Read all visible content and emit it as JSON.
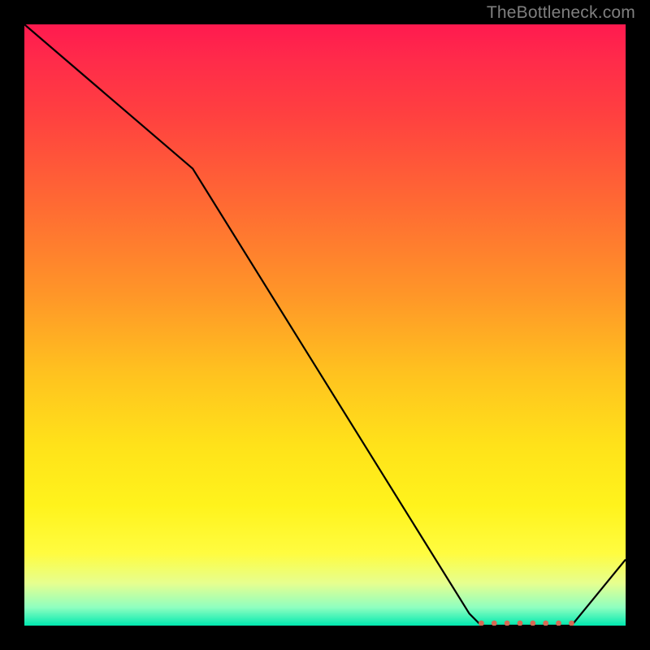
{
  "watermark": "TheBottleneck.com",
  "chart_data": {
    "type": "line",
    "title": "",
    "xlabel": "",
    "ylabel": "",
    "xlim": [
      0,
      100
    ],
    "ylim": [
      0,
      100
    ],
    "series": [
      {
        "name": "curve",
        "x": [
          0,
          28,
          74,
          76,
          91,
          100
        ],
        "values": [
          100,
          76,
          2,
          0,
          0,
          11
        ]
      }
    ],
    "markers": {
      "name": "bottom-dots",
      "x_range": [
        76,
        91
      ],
      "count": 8,
      "y": 0.4,
      "color": "#d86a55"
    },
    "gradient_stops": [
      {
        "pos": 0.0,
        "color": "#ff1a4f"
      },
      {
        "pos": 0.15,
        "color": "#ff4040"
      },
      {
        "pos": 0.45,
        "color": "#ff9628"
      },
      {
        "pos": 0.7,
        "color": "#ffe21a"
      },
      {
        "pos": 0.9,
        "color": "#fffc40"
      },
      {
        "pos": 1.0,
        "color": "#00e8b0"
      }
    ]
  }
}
